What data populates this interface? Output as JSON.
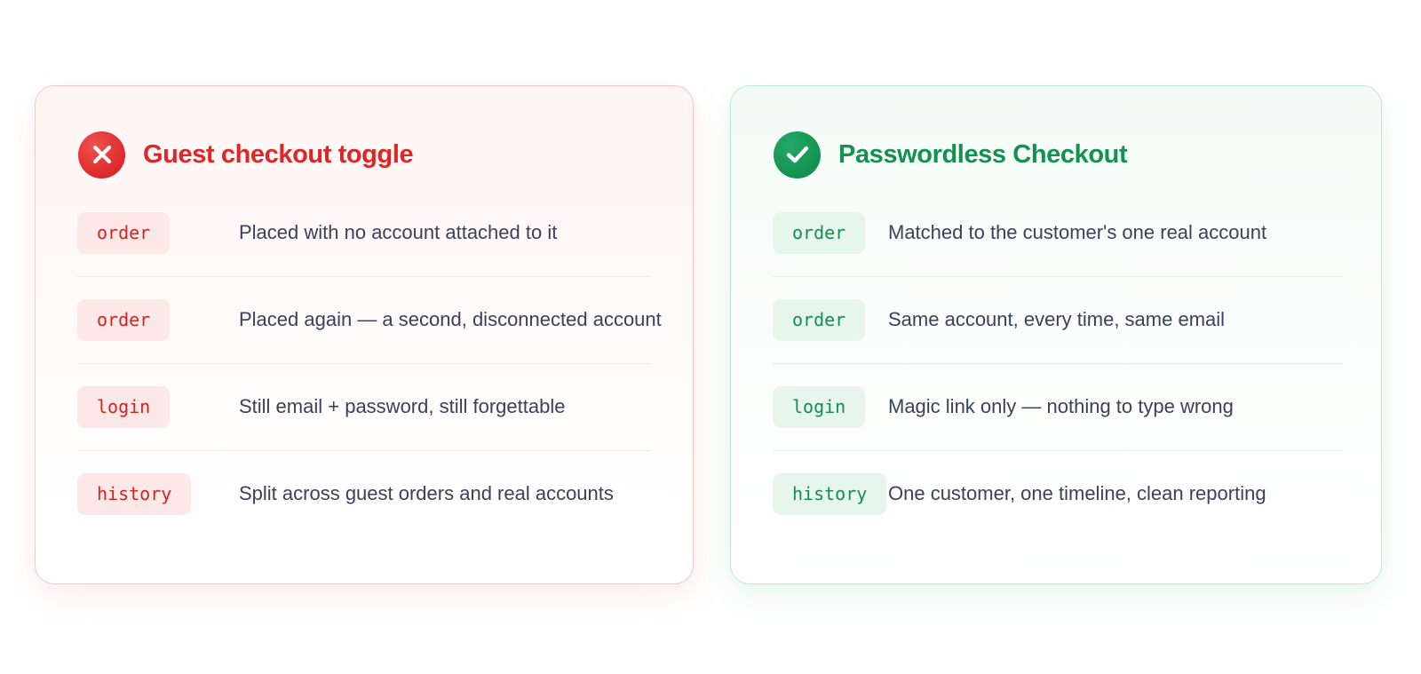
{
  "left_card": {
    "title": "Guest checkout toggle",
    "icon": "x-circle-icon",
    "accent_color": "#dd2626",
    "rows": [
      {
        "tag": "order",
        "text": "Placed with no account attached to it"
      },
      {
        "tag": "order",
        "text": "Placed again — a second, disconnected account"
      },
      {
        "tag": "login",
        "text": "Still email + password, still forgettable"
      },
      {
        "tag": "history",
        "text": "Split across guest orders and real accounts"
      }
    ]
  },
  "right_card": {
    "title": "Passwordless Checkout",
    "icon": "check-circle-icon",
    "accent_color": "#149150",
    "rows": [
      {
        "tag": "order",
        "text": "Matched to the customer's one real account"
      },
      {
        "tag": "order",
        "text": "Same account, every time, same email"
      },
      {
        "tag": "login",
        "text": "Magic link only — nothing to type wrong"
      },
      {
        "tag": "history",
        "text": "One customer, one timeline, clean reporting"
      }
    ]
  }
}
